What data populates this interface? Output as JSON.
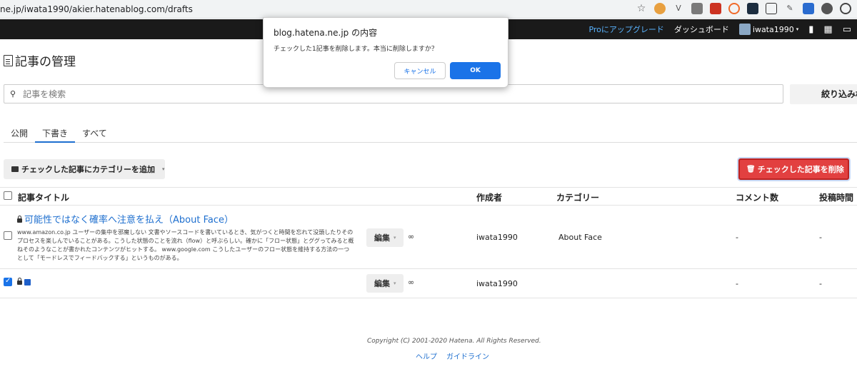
{
  "browser": {
    "url": "ne.jp/iwata1990/akier.hatenablog.com/drafts"
  },
  "topbar": {
    "pro_label": "Proにアップグレード",
    "dashboard_label": "ダッシュボード",
    "username": "iwata1990"
  },
  "page": {
    "title": "記事の管理"
  },
  "search": {
    "placeholder": "記事を検索",
    "filter_label": "絞り込み検"
  },
  "tabs": [
    {
      "label": "公開",
      "active": false
    },
    {
      "label": "下書き",
      "active": true
    },
    {
      "label": "すべて",
      "active": false
    }
  ],
  "actions": {
    "add_category_label": "チェックした記事にカテゴリーを追加",
    "delete_label": "チェックした記事を削除"
  },
  "table": {
    "headers": {
      "title": "記事タイトル",
      "author": "作成者",
      "category": "カテゴリー",
      "comments": "コメント数",
      "posted": "投稿時間"
    },
    "rows": [
      {
        "checked": false,
        "title": "可能性ではなく確率へ注意を払え（About Face）",
        "excerpt": "www.amazon.co.jp ユーザーの集中を邪魔しない 文書やソースコードを書いているとき、気がつくと時間を忘れて没頭したりそのプロセスを楽しんでいることがある。こうした状態のことを流れ（flow）と呼ぶらしい。確かに「フロー状態」とググってみると概ねそのようなことが書かれたコンテンツがヒットする。 www.google.com こうしたユーザーのフロー状態を維持する方法の一つとして「モードレスでフィードバックする」というものがある。",
        "edit_label": "編集",
        "author": "iwata1990",
        "category": "About Face",
        "comments": "-",
        "posted": "-"
      },
      {
        "checked": true,
        "title": "",
        "excerpt": "",
        "edit_label": "編集",
        "author": "iwata1990",
        "category": "",
        "comments": "-",
        "posted": "-"
      }
    ]
  },
  "footer": {
    "copyright": "Copyright (C) 2001-2020 Hatena. All Rights Reserved.",
    "links": [
      "ヘルプ",
      "ガイドライン"
    ]
  },
  "dialog": {
    "title": "blog.hatena.ne.jp の内容",
    "message": "チェックした1記事を削除します。本当に削除しますか？",
    "cancel_label": "キャンセル",
    "ok_label": "OK"
  },
  "colors": {
    "accent": "#1e6fcf",
    "danger": "#e24040",
    "topbar": "#1a1a1a"
  }
}
